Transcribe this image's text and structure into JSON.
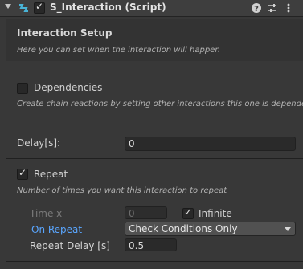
{
  "header": {
    "title": "S_Interaction (Script)",
    "enabled": true,
    "icons": [
      "foldout-arrow-icon",
      "script-icon",
      "help-icon",
      "preset-icon",
      "more-options-icon"
    ]
  },
  "interaction_setup": {
    "heading": "Interaction Setup",
    "description": "Here you can set when the interaction will happen"
  },
  "dependencies": {
    "label": "Dependencies",
    "checked": false,
    "description": "Create chain reactions by setting other interactions this one is depende"
  },
  "delay": {
    "label": "Delay[s]:",
    "value": "0"
  },
  "repeat": {
    "label": "Repeat",
    "checked": true,
    "description": "Number of times you want this interaction to repeat",
    "time_label": "Time x",
    "time_value": "0",
    "infinite_label": "Infinite",
    "infinite_checked": true,
    "on_repeat_label": "On Repeat",
    "on_repeat_value": "Check Conditions Only",
    "repeat_delay_label": "Repeat Delay [s]",
    "repeat_delay_value": "0.5"
  },
  "colors": {
    "background": "#383838",
    "header": "#3e3e3e",
    "link": "#5aa6ff"
  }
}
